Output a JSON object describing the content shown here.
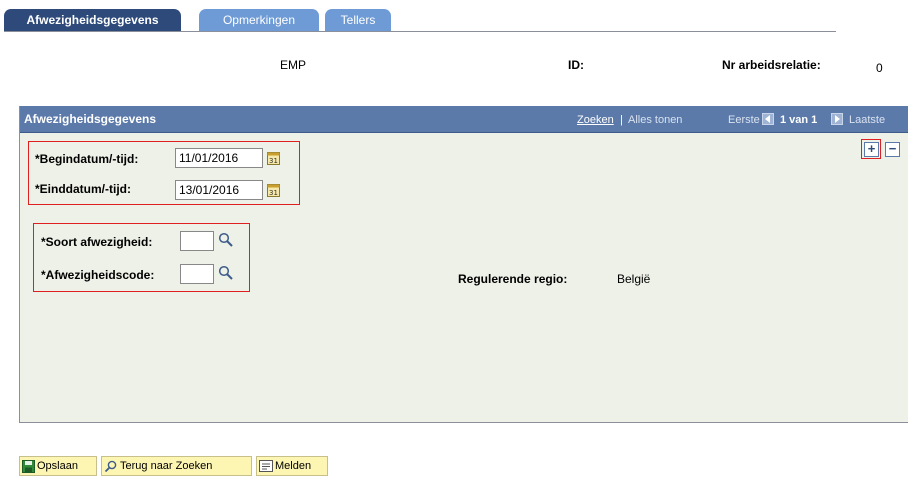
{
  "tabs": [
    {
      "label": "Afwezigheidsgegevens",
      "active": true
    },
    {
      "label": "Opmerkingen",
      "active": false
    },
    {
      "label": "Tellers",
      "active": false
    }
  ],
  "header": {
    "emp": "EMP",
    "id_label": "ID:",
    "nr_label": "Nr arbeidsrelatie:",
    "nr_value": "0"
  },
  "panel": {
    "title": "Afwezigheidsgegevens",
    "zoeken": "Zoeken",
    "separator": "|",
    "alles_tonen": "Alles tonen",
    "eerste": "Eerste",
    "van": "1 van 1",
    "laatste": "Laatste",
    "add_label": "+",
    "remove_label": "−"
  },
  "form": {
    "begindatum_label": "*Begindatum/-tijd:",
    "begindatum_value": "11/01/2016",
    "einddatum_label": "*Einddatum/-tijd:",
    "einddatum_value": "13/01/2016",
    "soort_label": "*Soort afwezigheid:",
    "soort_value": "",
    "code_label": "*Afwezigheidscode:",
    "code_value": "",
    "regio_label": "Regulerende regio:",
    "regio_value": "België"
  },
  "toolbar": {
    "save_label": "Opslaan",
    "back_label": "Terug naar Zoeken",
    "notify_label": "Melden"
  },
  "colors": {
    "active_tab": "#2d4a7a",
    "inactive_tab": "#6e9bd6",
    "panel_header": "#5b7aaa",
    "panel_bg": "#eef1e7",
    "highlight": "#e02020",
    "toolbar_button": "#fdf6b3"
  },
  "icons": [
    "calendar-icon",
    "lookup-icon",
    "save-icon",
    "search-back-icon",
    "notify-icon",
    "first-arrow-icon",
    "next-arrow-icon"
  ]
}
